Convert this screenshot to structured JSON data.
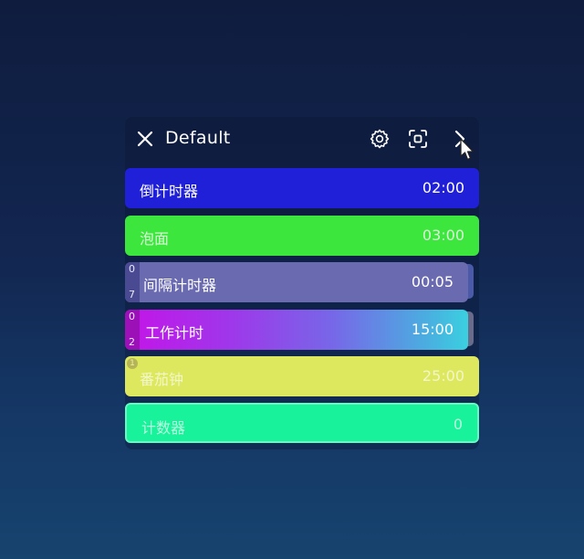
{
  "header": {
    "title": "Default",
    "icons": {
      "close": "close-icon",
      "settings": "gear-icon",
      "screenshot": "focus-frame-icon",
      "next": "chevron-right-icon"
    }
  },
  "timers": [
    {
      "name": "倒计时器",
      "time": "02:00",
      "color": "#2020d8"
    },
    {
      "name": "泡面",
      "time": "03:00",
      "color": "#3de63d"
    },
    {
      "name": "间隔计时器",
      "time": "00:05",
      "color": "#6a6ab0",
      "badge_top": "0",
      "badge_bottom": "7"
    },
    {
      "name": "工作计时",
      "time": "15:00",
      "color": "#c414e8",
      "badge_top": "0",
      "badge_bottom": "2"
    },
    {
      "name": "番茄钟",
      "time": "25:00",
      "color": "#dde85e",
      "badge_top": "1"
    },
    {
      "name": "计数器",
      "time": "0",
      "color": "#18f29a"
    }
  ]
}
